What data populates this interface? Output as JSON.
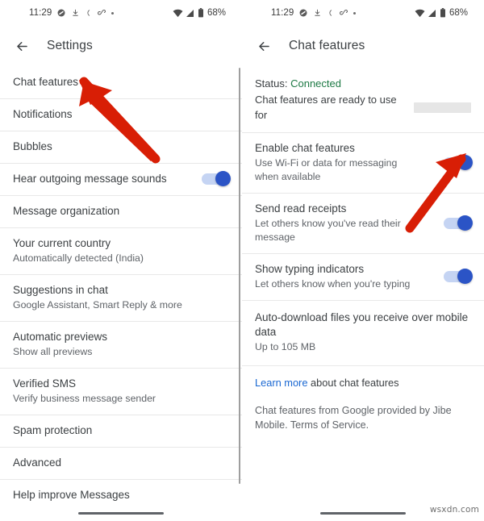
{
  "status_bar": {
    "time": "11:29",
    "left_icons": [
      "dnd-icon",
      "downloads-icon",
      "crescent-moon-icon",
      "screen-record-icon",
      "more-dot-icon"
    ],
    "right_icons": [
      "wifi-icon",
      "signal-icon",
      "battery-icon"
    ],
    "battery": "68%"
  },
  "left_panel": {
    "appbar": {
      "back_icon": "back-arrow-icon",
      "title": "Settings"
    },
    "items": [
      {
        "title": "Chat features",
        "sub": "",
        "toggle": null
      },
      {
        "title": "Notifications",
        "sub": "",
        "toggle": null
      },
      {
        "title": "Bubbles",
        "sub": "",
        "toggle": null
      },
      {
        "title": "Hear outgoing message sounds",
        "sub": "",
        "toggle": "on"
      },
      {
        "title": "Message organization",
        "sub": "",
        "toggle": null
      },
      {
        "title": "Your current country",
        "sub": "Automatically detected (India)",
        "toggle": null
      },
      {
        "title": "Suggestions in chat",
        "sub": "Google Assistant, Smart Reply & more",
        "toggle": null
      },
      {
        "title": "Automatic previews",
        "sub": "Show all previews",
        "toggle": null
      },
      {
        "title": "Verified SMS",
        "sub": "Verify business message sender",
        "toggle": null
      },
      {
        "title": "Spam protection",
        "sub": "",
        "toggle": null
      },
      {
        "title": "Advanced",
        "sub": "",
        "toggle": null
      },
      {
        "title": "Help improve Messages",
        "sub": "",
        "toggle": null
      }
    ]
  },
  "right_panel": {
    "appbar": {
      "back_icon": "back-arrow-icon",
      "title": "Chat features"
    },
    "status": {
      "label": "Status:",
      "value": "Connected",
      "description": "Chat features are ready to use for",
      "redacted": true
    },
    "items": [
      {
        "title": "Enable chat features",
        "sub": "Use Wi-Fi or data for messaging when available",
        "toggle": "on"
      },
      {
        "title": "Send read receipts",
        "sub": "Let others know you've read their message",
        "toggle": "on"
      },
      {
        "title": "Show typing indicators",
        "sub": "Let others know when you're typing",
        "toggle": "on"
      },
      {
        "title": "Auto-download files you receive over mobile data",
        "sub": "Up to 105 MB",
        "toggle": null
      }
    ],
    "learn_more": {
      "link_text": "Learn more",
      "rest_text": " about chat features"
    },
    "footnote": "Chat features from Google provided by Jibe Mobile. Terms of Service."
  },
  "annotations": {
    "arrows": [
      {
        "name": "arrow-pointing-chat-features",
        "color": "#D81E05"
      },
      {
        "name": "arrow-pointing-enable-chat-features-toggle",
        "color": "#D81E05"
      }
    ]
  },
  "watermark": "wsxdn.com",
  "colors": {
    "accent_blue": "#2b54c6",
    "link_blue": "#1967d2",
    "status_green": "#1e7a45",
    "arrow_red": "#D81E05",
    "divider": "#e8e8e8"
  }
}
